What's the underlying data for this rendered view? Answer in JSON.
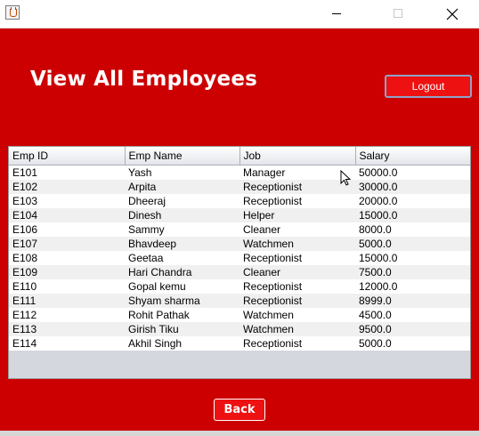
{
  "window": {
    "app_icon": "java-icon",
    "controls": [
      "minimize-icon",
      "maximize-icon",
      "close-icon"
    ]
  },
  "header": {
    "title": "View All Employees",
    "logout_label": "Logout"
  },
  "table": {
    "columns": [
      "Emp ID",
      "Emp Name",
      "Job",
      "Salary"
    ],
    "rows": [
      [
        "E101",
        "Yash",
        "Manager",
        "50000.0"
      ],
      [
        "E102",
        "Arpita",
        "Receptionist",
        "30000.0"
      ],
      [
        "E103",
        "Dheeraj",
        "Receptionist",
        "20000.0"
      ],
      [
        "E104",
        "Dinesh",
        "Helper",
        "15000.0"
      ],
      [
        "E106",
        "Sammy",
        "Cleaner",
        "8000.0"
      ],
      [
        "E107",
        "Bhavdeep",
        "Watchmen",
        "5000.0"
      ],
      [
        "E108",
        "Geetaa",
        "Receptionist",
        "15000.0"
      ],
      [
        "E109",
        "Hari Chandra",
        "Cleaner",
        "7500.0"
      ],
      [
        "E110",
        "Gopal kemu",
        "Receptionist",
        "12000.0"
      ],
      [
        "E111",
        "Shyam sharma",
        "Receptionist",
        "8999.0"
      ],
      [
        "E112",
        "Rohit Pathak",
        "Watchmen",
        "4500.0"
      ],
      [
        "E113",
        "Girish Tiku",
        "Watchmen",
        "9500.0"
      ],
      [
        "E114",
        "Akhil Singh",
        "Receptionist",
        "5000.0"
      ]
    ]
  },
  "footer": {
    "back_label": "Back"
  },
  "colors": {
    "background": "#cc0000",
    "button": "#ee1111",
    "table_empty": "#d4d7de"
  }
}
